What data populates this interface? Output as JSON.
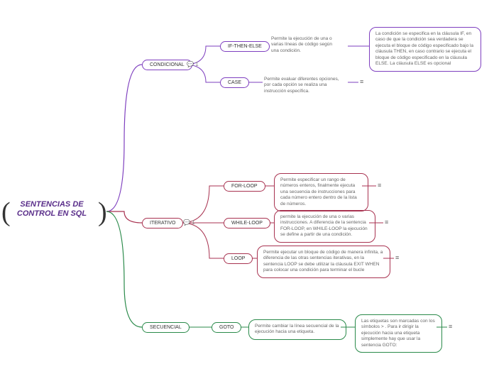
{
  "root": "SENTENCIAS DE CONTROL EN SQL",
  "branches": {
    "condicional": {
      "label": "CONDICIONAL",
      "comment": "1",
      "children": {
        "ifthenelse": {
          "label": "IF-THEN-ELSE",
          "desc": "Permite la ejecución de una o varias líneas de código según una condición.",
          "detail": "La condición se especifica en la cláusula IF, en caso de que la condición sea verdadera se ejecuta el bloque de código especificado bajo la cláusula THEN, en caso contrario se ejecuta el bloque de código especificado en la cláusula ELSE. La cláusula ELSE es opcional"
        },
        "case": {
          "label": "CASE",
          "desc": "Permite evaluar diferentes opciones, por cada opción se realiza una instrucción específica."
        }
      }
    },
    "iterativo": {
      "label": "ITERATIVO",
      "comment": "1",
      "children": {
        "forloop": {
          "label": "FOR-LOOP",
          "desc": "Permite especificar un rango de números enteros, finalmente ejecuta una secuencia de instrucciones para cada número entero dentro de la lista de números."
        },
        "whileloop": {
          "label": "WHILE-LOOP",
          "desc": " permite la ejecución de una o varias instrucciones. A diferencia de la sentencia FOR-LOOP, en WHILE-LOOP la ejecución se define a partir de una condición."
        },
        "loop": {
          "label": "LOOP",
          "desc": " Permite ejecutar un bloque de código de manera infinita, a diferencia de las otras sentencias iterativas, en la sentencia LOOP se debe utilizar la cláusula EXIT WHEN para colocar una condición para terminar el bucle"
        }
      }
    },
    "secuencial": {
      "label": "SECUENCIAL",
      "children": {
        "goto": {
          "label": "GOTO",
          "desc": "Permite cambiar la línea secuencial de la ejecución hacia una etiqueta.",
          "detail": "Las etiquetas son marcadas con los símbolos > . Para ir dirigir la ejecución hacia una etiqueta simplemente hay que usar la sentencia GOTO:"
        }
      }
    }
  },
  "icons": {
    "comment": "💬",
    "menu": "≡"
  }
}
